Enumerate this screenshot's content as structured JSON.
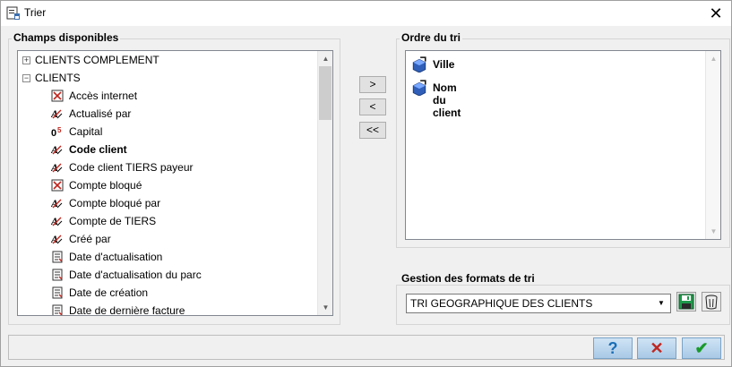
{
  "window": {
    "title": "Trier",
    "close_label": "✕"
  },
  "champs": {
    "title": "Champs disponibles",
    "tree": [
      {
        "label": "CLIENTS COMPLEMENT",
        "expander": "+",
        "icon": "expander-plus-icon"
      },
      {
        "label": "CLIENTS",
        "expander": "−",
        "icon": "expander-minus-icon"
      },
      {
        "label": "Accès internet",
        "icon": "checkbox-field-icon"
      },
      {
        "label": "Actualisé par",
        "icon": "text-field-icon"
      },
      {
        "label": "Capital",
        "icon": "numeric-field-icon"
      },
      {
        "label": "Code client",
        "icon": "text-field-icon",
        "bold": true
      },
      {
        "label": "Code client TIERS payeur",
        "icon": "text-field-icon"
      },
      {
        "label": "Compte bloqué",
        "icon": "checkbox-field-icon"
      },
      {
        "label": "Compte bloqué par",
        "icon": "text-field-icon"
      },
      {
        "label": "Compte de TIERS",
        "icon": "text-field-icon"
      },
      {
        "label": "Créé par",
        "icon": "text-field-icon"
      },
      {
        "label": "Date d'actualisation",
        "icon": "date-field-icon"
      },
      {
        "label": "Date d'actualisation du parc",
        "icon": "date-field-icon"
      },
      {
        "label": "Date de création",
        "icon": "date-field-icon"
      },
      {
        "label": "Date de dernière facture",
        "icon": "date-field-icon"
      }
    ]
  },
  "transfer": {
    "add": ">",
    "remove": "<",
    "remove_all": "<<"
  },
  "ordre": {
    "title": "Ordre du tri",
    "items": [
      {
        "label": "Ville",
        "icon": "sort-field-icon"
      },
      {
        "label": "Nom du client",
        "icon": "sort-field-icon"
      }
    ]
  },
  "gestion": {
    "title": "Gestion des formats de tri",
    "selected": "TRI GEOGRAPHIQUE DES CLIENTS",
    "save_icon": "floppy-disk-icon",
    "delete_icon": "trash-icon"
  },
  "footer": {
    "help": "?",
    "cancel": "✕",
    "ok": "✔"
  },
  "colors": {
    "help": "#1a6fb7",
    "cancel": "#c0261f",
    "ok": "#1a9a2a",
    "accent_btn": "#a9c9e6"
  }
}
